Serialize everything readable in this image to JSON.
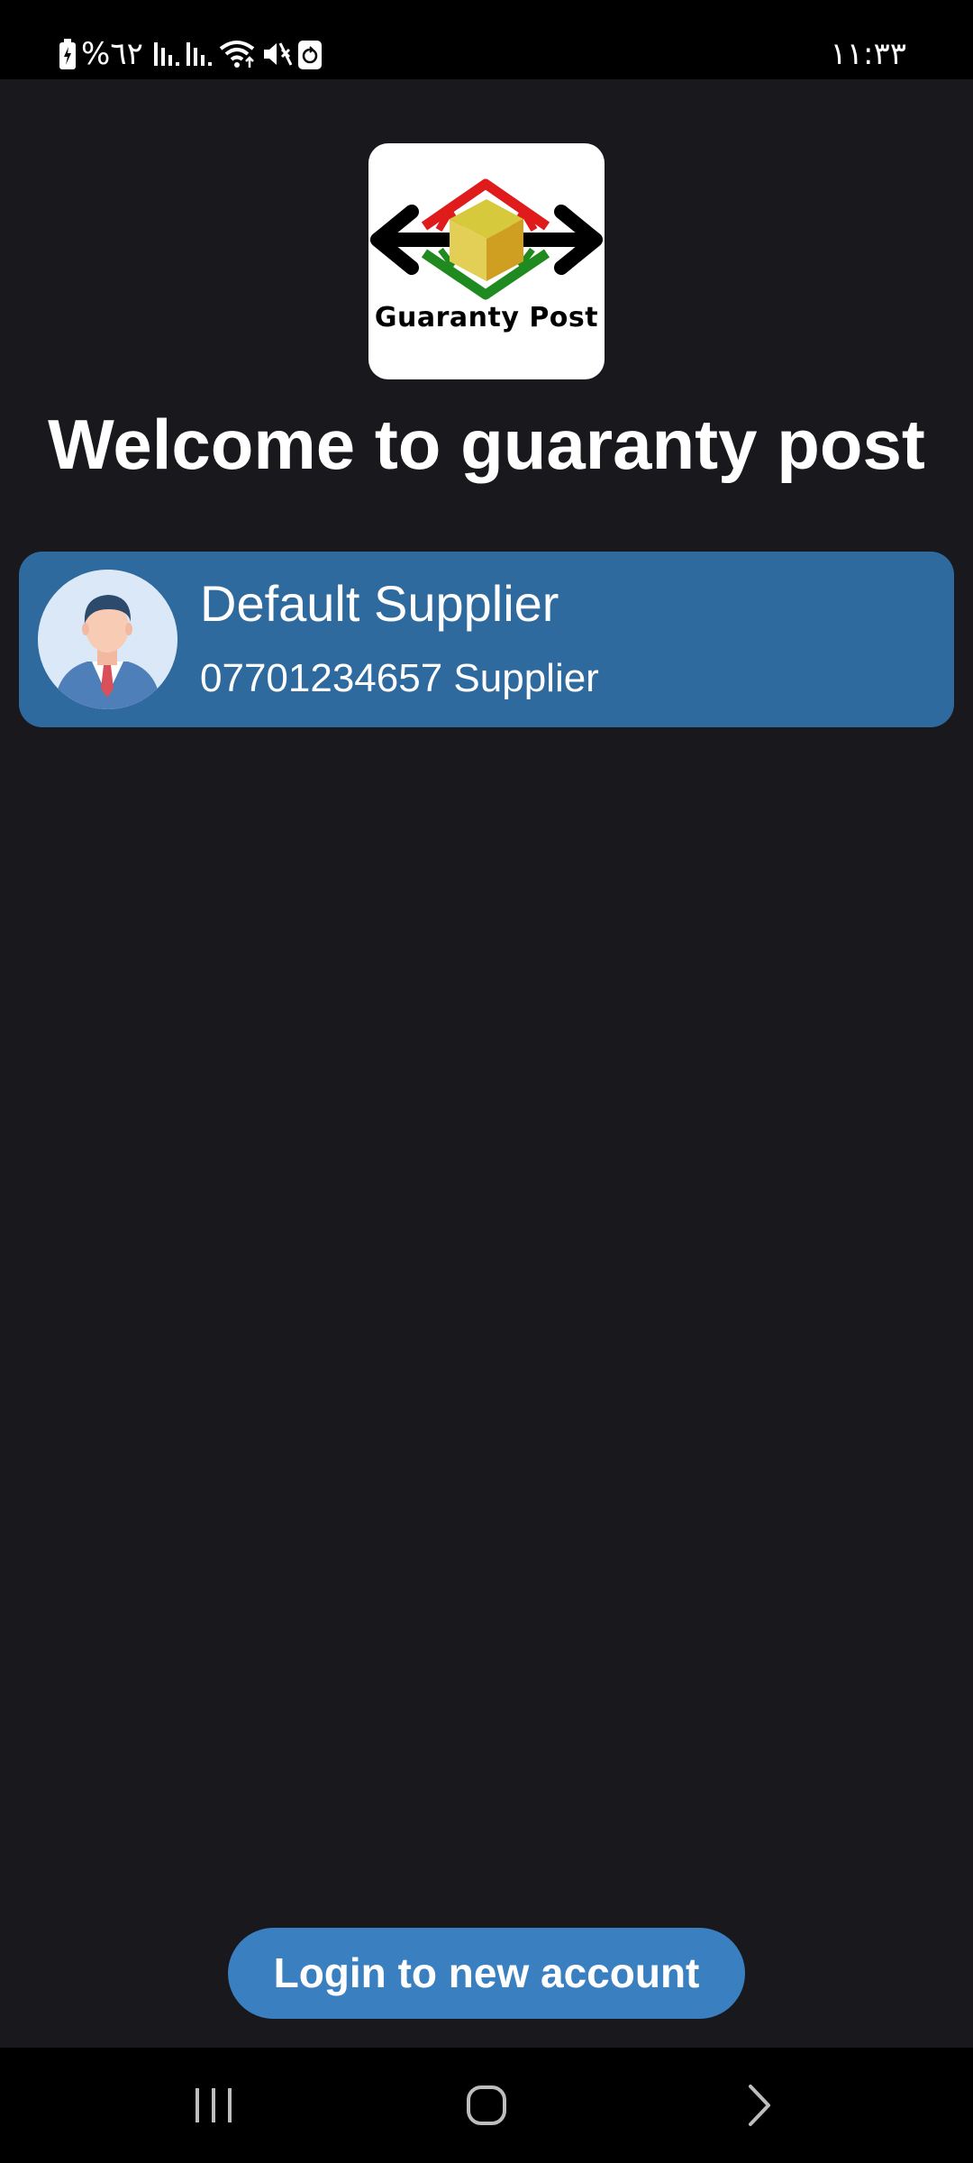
{
  "status_bar": {
    "battery_text": "%٦٢",
    "time": "١١:٣٣",
    "icons": [
      "battery-icon",
      "signal-icon",
      "signal-icon",
      "wifi-icon",
      "mute-icon",
      "recycle-icon"
    ]
  },
  "logo": {
    "brand_text": "Guaranty Post",
    "colors": {
      "red": "#e01b1b",
      "green": "#1f8a1f",
      "box": "#d9b93a",
      "arrows": "#000000"
    }
  },
  "welcome": {
    "title": "Welcome to guaranty post"
  },
  "account": {
    "name": "Default Supplier",
    "detail": "07701234657 Supplier",
    "avatar_icon": "user-avatar-icon"
  },
  "actions": {
    "login_new": "Login to new account"
  },
  "nav": {
    "icons": [
      "recent-apps-icon",
      "home-icon",
      "back-icon"
    ]
  },
  "colors": {
    "background": "#19181d",
    "card": "#2f6a9f",
    "button": "#3a7fc0"
  }
}
